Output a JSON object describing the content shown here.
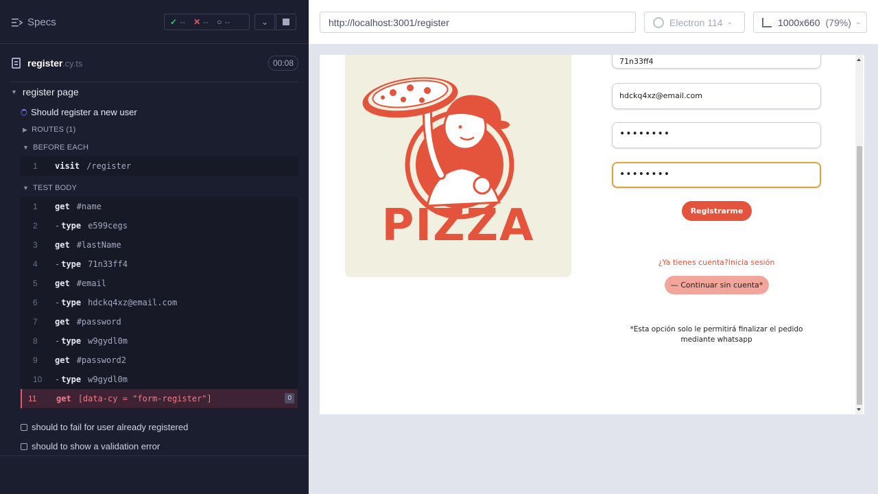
{
  "left": {
    "header": {
      "title": "Specs",
      "stats": {
        "passed": "--",
        "failed": "--",
        "pending": "--"
      }
    },
    "file": {
      "name": "register",
      "ext": ".cy.ts",
      "duration": "00:08"
    },
    "suite": {
      "title": "register page"
    },
    "test": {
      "title": "Should register a new user"
    },
    "sections": {
      "routes": "ROUTES (1)",
      "before_each": "BEFORE EACH",
      "test_body": "TEST BODY"
    },
    "before_each_cmds": [
      {
        "num": "1",
        "name": "visit",
        "msg": "/register"
      }
    ],
    "test_body_cmds": [
      {
        "num": "1",
        "name": "get",
        "msg": "#name"
      },
      {
        "num": "2",
        "name": "type",
        "msg": "e599cegs"
      },
      {
        "num": "3",
        "name": "get",
        "msg": "#lastName"
      },
      {
        "num": "4",
        "name": "type",
        "msg": "71n33ff4"
      },
      {
        "num": "5",
        "name": "get",
        "msg": "#email"
      },
      {
        "num": "6",
        "name": "type",
        "msg": "hdckq4xz@email.com"
      },
      {
        "num": "7",
        "name": "get",
        "msg": "#password"
      },
      {
        "num": "8",
        "name": "type",
        "msg": "w9gydl0m"
      },
      {
        "num": "9",
        "name": "get",
        "msg": "#password2"
      },
      {
        "num": "10",
        "name": "type",
        "msg": "w9gydl0m"
      },
      {
        "num": "11",
        "name": "get",
        "msg": "[data-cy = \"form-register\"]",
        "badge": "0"
      }
    ],
    "other_tests": [
      "should to fail for user already registered",
      "should to show a validation error"
    ]
  },
  "right": {
    "url": "http://localhost:3001/register",
    "browser": "Electron 114",
    "viewport": "1000x660",
    "scale": "(79%)",
    "app": {
      "fields": {
        "lastname_value": "71n33ff4",
        "email_value": "hdckq4xz@email.com",
        "password_value": "••••••••",
        "password2_value": "••••••••"
      },
      "logo_text": "PIZZA",
      "register_button": "Registrarme",
      "login_prompt": "¿Ya tienes cuenta?",
      "login_link": "Inicia sesión",
      "guest_button": "— Continuar sin cuenta*",
      "note": "*Esta opción solo le permitirá finalizar el pedido mediante whatsapp"
    }
  },
  "colors": {
    "reporter_bg": "#1b1e2e",
    "error_red": "#e05d6f",
    "pizza_red": "#e4533b",
    "focus_gold": "#d9a63e"
  }
}
